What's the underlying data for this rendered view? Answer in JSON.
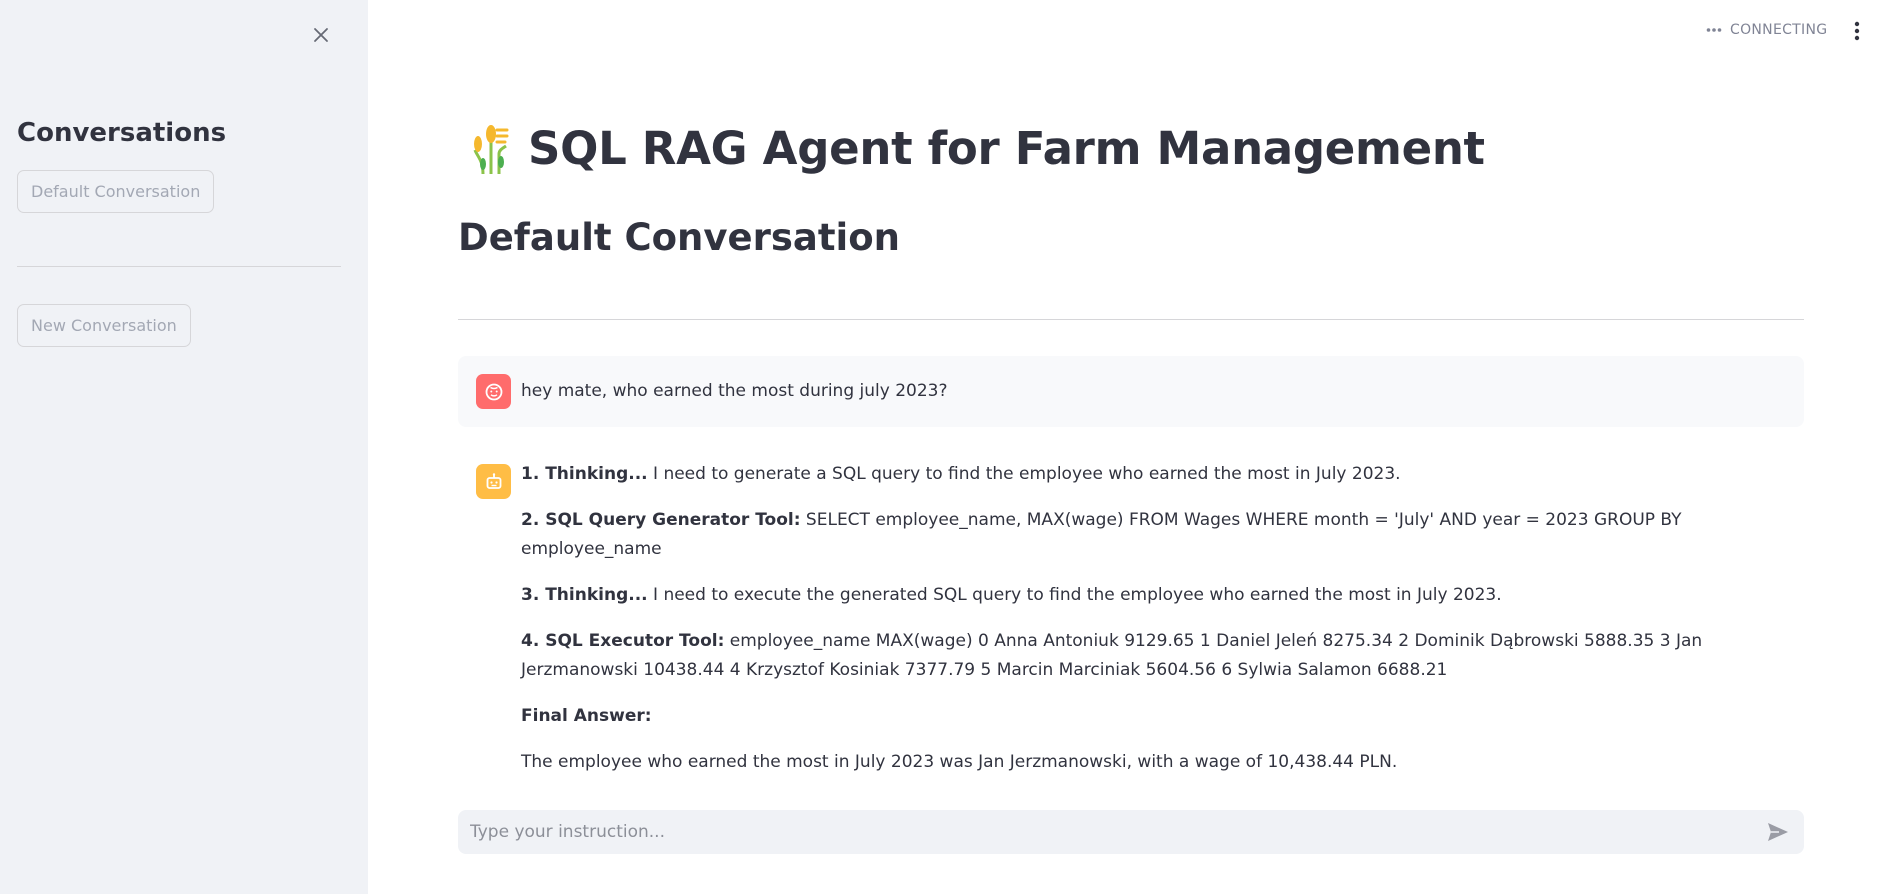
{
  "sidebar": {
    "heading": "Conversations",
    "conversations": [
      {
        "label": "Default Conversation"
      }
    ],
    "new_conversation_label": "New Conversation"
  },
  "header": {
    "status_text": "CONNECTING"
  },
  "main": {
    "title": "SQL RAG Agent for Farm Management",
    "conversation_title": "Default Conversation"
  },
  "messages": {
    "user": {
      "text": "hey mate, who earned the most during july 2023?"
    },
    "assistant": {
      "steps": [
        {
          "label": "1. Thinking...",
          "text": " I need to generate a SQL query to find the employee who earned the most in July 2023."
        },
        {
          "label": "2. SQL Query Generator Tool:",
          "text": " SELECT employee_name, MAX(wage) FROM Wages WHERE month = 'July' AND year = 2023 GROUP BY employee_name"
        },
        {
          "label": "3. Thinking...",
          "text": " I need to execute the generated SQL query to find the employee who earned the most in July 2023."
        },
        {
          "label": "4. SQL Executor Tool:",
          "text": " employee_name MAX(wage) 0 Anna Antoniuk 9129.65 1 Daniel Jeleń 8275.34 2 Dominik Dąbrowski 5888.35 3 Jan Jerzmanowski 10438.44 4 Krzysztof Kosiniak 7377.79 5 Marcin Marciniak 5604.56 6 Sylwia Salamon 6688.21"
        }
      ],
      "final_answer_label": "Final Answer:",
      "final_answer_text": "The employee who earned the most in July 2023 was Jan Jerzmanowski, with a wage of 10,438.44 PLN."
    }
  },
  "chat_input": {
    "placeholder": "Type your instruction..."
  },
  "colors": {
    "sidebar_bg": "#f0f2f6",
    "user_avatar": "#ff6c6c",
    "assistant_avatar": "#ffbd45",
    "text": "#31333f"
  },
  "icons": {
    "close": "close-icon",
    "menu": "kebab-menu-icon",
    "status": "connecting-dots-icon",
    "title": "wheat-icon",
    "user_avatar": "user-face-icon",
    "assistant_avatar": "robot-icon",
    "send": "send-icon"
  }
}
